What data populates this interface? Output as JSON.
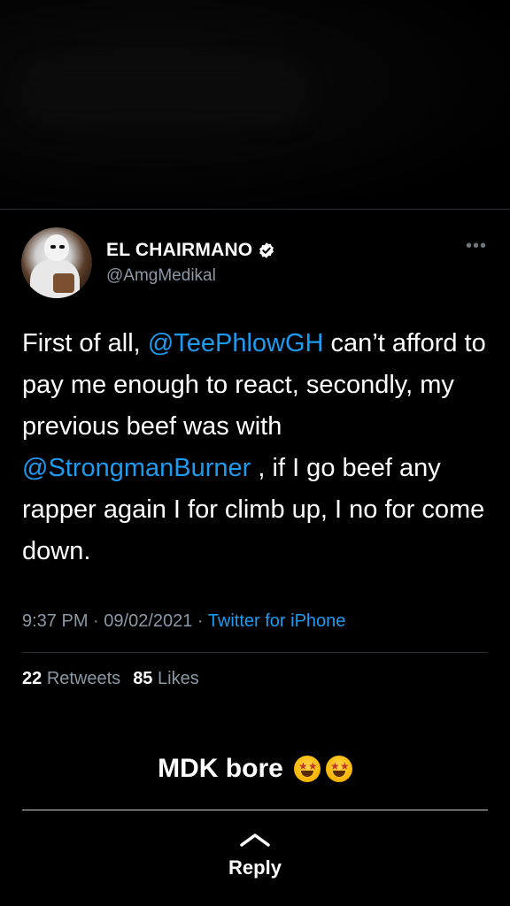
{
  "tweet": {
    "display_name": "EL CHAIRMANO",
    "handle": "@AmgMedikal",
    "verified": true,
    "body": {
      "t1": "First of all, ",
      "mention1": "@TeePhlowGH",
      "t2": " can’t afford to pay me enough to react, secondly, my previous beef was with ",
      "mention2": "@StrongmanBurner",
      "t3": " , if I go beef any rapper again I for climb up, I no for come down."
    },
    "time": "9:37 PM",
    "separator": " · ",
    "date": "09/02/2021",
    "source": "Twitter for iPhone",
    "retweets_count": "22",
    "retweets_label": "Retweets",
    "likes_count": "85",
    "likes_label": "Likes"
  },
  "caption": {
    "text": "MDK bore",
    "emojis": [
      "star-struck-emoji",
      "star-struck-emoji"
    ]
  },
  "reply": {
    "label": "Reply"
  },
  "colors": {
    "background": "#000000",
    "link": "#1d9bf0",
    "secondary_text": "#8b98a5",
    "divider": "#2a2f33"
  }
}
